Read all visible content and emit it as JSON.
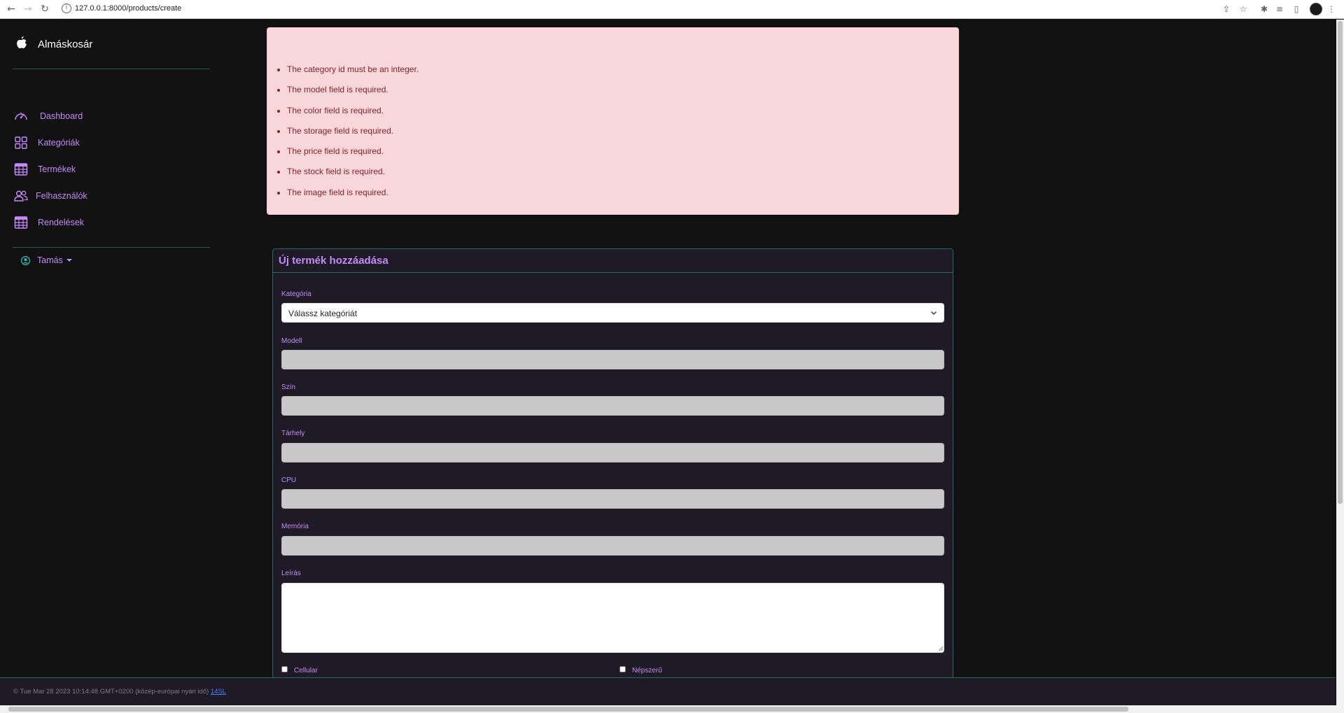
{
  "browser": {
    "url": "127.0.0.1:8000/products/create"
  },
  "sidebar": {
    "brand": "Almáskosár",
    "brand_icon": "apple-icon",
    "items": [
      {
        "label": "Dashboard",
        "icon": "speedometer-icon"
      },
      {
        "label": "Kategóriák",
        "icon": "grid-icon"
      },
      {
        "label": "Termékek",
        "icon": "table-icon"
      },
      {
        "label": "Felhasználók",
        "icon": "people-icon"
      },
      {
        "label": "Rendelések",
        "icon": "table-icon"
      }
    ],
    "user": {
      "label": "Tamás",
      "icon": "person-circle-icon"
    }
  },
  "alert": {
    "errors": [
      "The category id must be an integer.",
      "The model field is required.",
      "The color field is required.",
      "The storage field is required.",
      "The price field is required.",
      "The stock field is required.",
      "The image field is required."
    ]
  },
  "form": {
    "title": "Új termék hozzáadása",
    "category": {
      "label": "Kategória",
      "value": "Válassz kategóriát"
    },
    "model": {
      "label": "Modell",
      "value": ""
    },
    "color": {
      "label": "Szín",
      "value": ""
    },
    "storage": {
      "label": "Tárhely",
      "value": ""
    },
    "cpu": {
      "label": "CPU",
      "value": ""
    },
    "memory": {
      "label": "Memória",
      "value": ""
    },
    "description": {
      "label": "Leírás",
      "value": ""
    },
    "cellular": {
      "label": "Cellular",
      "checked": false
    },
    "popular": {
      "label": "Népszerű",
      "checked": false
    }
  },
  "footer": {
    "text": "© Tue Mar 28 2023 10:14:48 GMT+0200 (közép-európai nyári idő)",
    "link": "14SL"
  },
  "colors": {
    "accent": "#c58af9",
    "teal": "#1e6a5c",
    "background": "#111111",
    "card": "#1e1b26",
    "alert_bg": "#f8d7da",
    "alert_text": "#842029"
  }
}
